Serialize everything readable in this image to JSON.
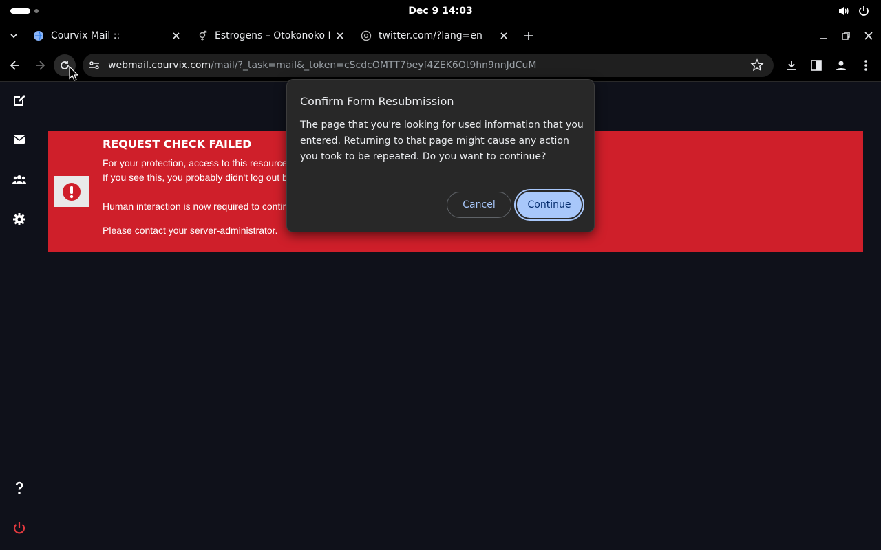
{
  "system": {
    "clock": "Dec 9  14:03"
  },
  "tabs": [
    {
      "title": "Courvix Mail ::",
      "icon": "mail-globe-icon"
    },
    {
      "title": "Estrogens – Otokonoko Pha",
      "icon": "gender-symbol-icon"
    },
    {
      "title": "twitter.com/?lang=en",
      "icon": "globe-icon"
    }
  ],
  "address_bar": {
    "host": "webmail.courvix.com",
    "path": "/mail/?_task=mail&_token=cScdcOMTT7beyf4ZEK6Ot9hn9nnJdCuM"
  },
  "alert": {
    "title": "REQUEST CHECK FAILED",
    "lines": [
      "For your protection, access to this resource",
      "If you see this, you probably didn't log out b",
      "Human interaction is now required to contin",
      "Please contact your server-administrator."
    ]
  },
  "dialog": {
    "title": "Confirm Form Resubmission",
    "body": "The page that you're looking for used information that you entered. Returning to that page might cause any action you took to be repeated. Do you want to continue?",
    "cancel_label": "Cancel",
    "continue_label": "Continue"
  },
  "colors": {
    "accent": "#a8c7fa",
    "alert_bg": "#cf1f2a",
    "power": "#e0393e"
  }
}
